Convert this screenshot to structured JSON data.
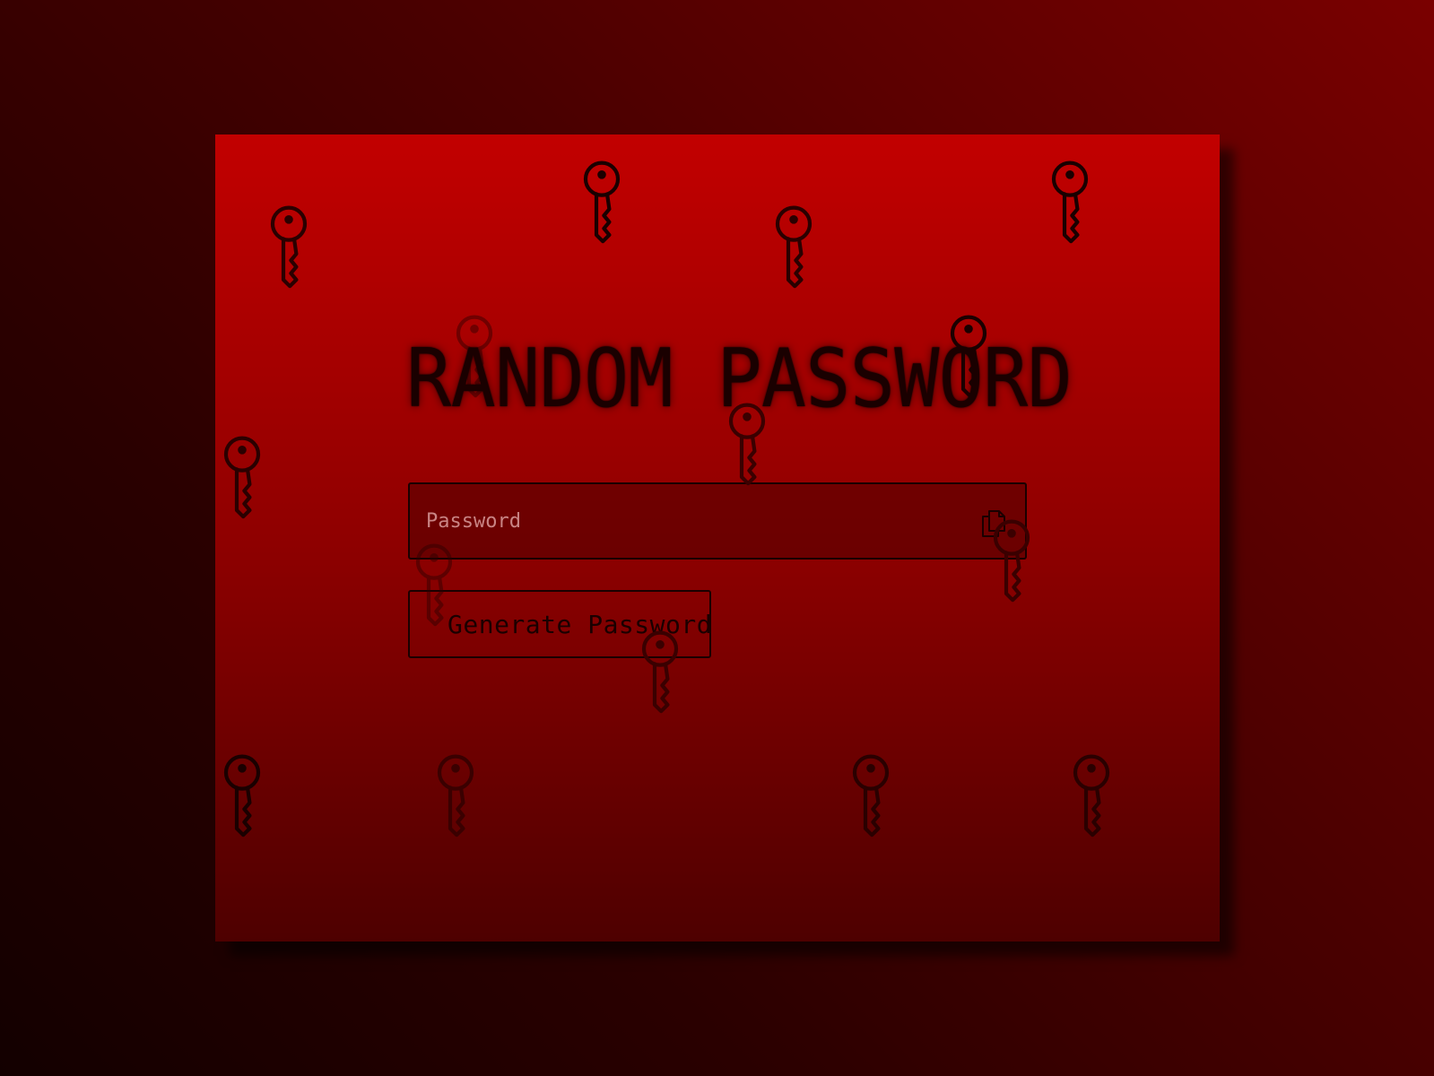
{
  "app": {
    "title": "RANDOM PASSWORD"
  },
  "password_field": {
    "placeholder": "Password",
    "value": "",
    "copy_icon": "copy-icon"
  },
  "generate_button": {
    "label": "Generate Password",
    "icon": "key-icon"
  },
  "background": {
    "decoration_icon": "key-icon"
  },
  "colors": {
    "accent": "#c20000",
    "text": "#1a0000",
    "placeholder": "#c98484"
  }
}
